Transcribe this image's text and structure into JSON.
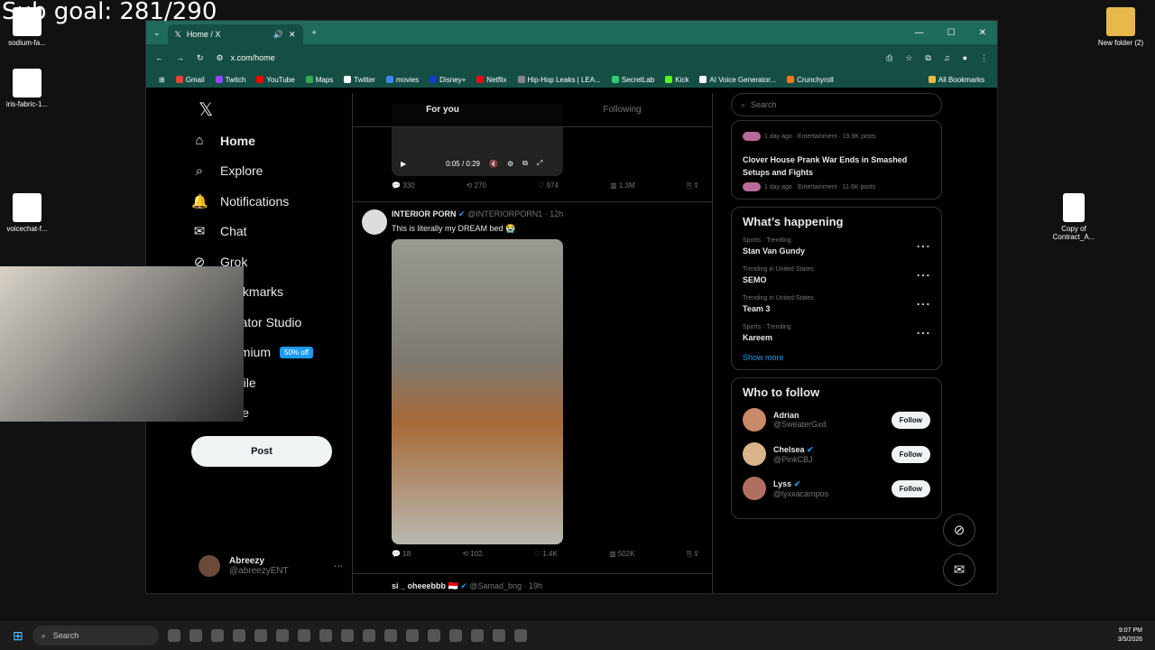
{
  "overlay": {
    "goal": "Sub goal: 281/290"
  },
  "desktop": {
    "icons": [
      "sodium-fa...",
      "iris-fabric-1...",
      "voicechat-f...",
      "New folder (2)",
      "Copy of Contract_A..."
    ]
  },
  "browser": {
    "tab_title": "Home / X",
    "url": "x.com/home",
    "bookmarks": [
      "Gmail",
      "Twitch",
      "YouTube",
      "Maps",
      "Twitter",
      "movies",
      "Disney+",
      "Netflix",
      "Hip-Hop Leaks | LEA...",
      "SecretLab",
      "Kick",
      "AI Voice Generator...",
      "Crunchyroll",
      "All Bookmarks"
    ]
  },
  "nav": {
    "items": [
      {
        "label": "Home",
        "icon": "⌂"
      },
      {
        "label": "Explore",
        "icon": "⌕"
      },
      {
        "label": "Notifications",
        "icon": "🔔"
      },
      {
        "label": "Chat",
        "icon": "✉"
      },
      {
        "label": "Grok",
        "icon": "⊘"
      },
      {
        "label": "Bookmarks",
        "icon": "⎘"
      },
      {
        "label": "Creator Studio",
        "icon": "✎"
      },
      {
        "label": "Premium",
        "icon": "X"
      },
      {
        "label": "Profile",
        "icon": "👤"
      },
      {
        "label": "More",
        "icon": "⋯"
      }
    ],
    "premium_badge": "50% off",
    "post_label": "Post",
    "account": {
      "name": "Abreezy",
      "handle": "@abreezyENT"
    }
  },
  "feed": {
    "tabs": [
      "For you",
      "Following"
    ],
    "tweet1": {
      "video_time": "0:05 / 0:29",
      "replies": "330",
      "reposts": "270",
      "likes": "974",
      "views": "1.3M"
    },
    "tweet2": {
      "name": "INTERIOR PORN",
      "handle": "@INTERIORPORN1 · 12h",
      "text": "This is literally my DREAM bed 😭",
      "replies": "18",
      "reposts": "102",
      "likes": "1.4K",
      "views": "502K"
    },
    "tweet3": {
      "name": "si _ oheeebbb 🇮🇩",
      "handle": "@Samad_bng · 19h"
    }
  },
  "sidebar": {
    "search_placeholder": "Search",
    "news": [
      {
        "meta": "1 day ago · Entertainment · 19.9K posts"
      },
      {
        "title": "Clover House Prank War Ends in Smashed Setups and Fights",
        "meta": "1 day ago · Entertainment · 11.6K posts"
      }
    ],
    "happening_title": "What’s happening",
    "trends": [
      {
        "context": "Sports · Trending",
        "title": "Stan Van Gundy"
      },
      {
        "context": "Trending in United States",
        "title": "SEMO"
      },
      {
        "context": "Trending in United States",
        "title": "Team 3"
      },
      {
        "context": "Sports · Trending",
        "title": "Kareem"
      }
    ],
    "show_more": "Show more",
    "follow_title": "Who to follow",
    "follow": [
      {
        "name": "Adrian",
        "handle": "@SweaterGxd",
        "button": "Follow"
      },
      {
        "name": "Chelsea",
        "handle": "@PinkCBJ",
        "button": "Follow"
      },
      {
        "name": "Lyss",
        "handle": "@lyxxacampos",
        "button": "Follow"
      }
    ]
  },
  "taskbar": {
    "search": "Search",
    "time": "9:07 PM",
    "date": "3/5/2026"
  }
}
